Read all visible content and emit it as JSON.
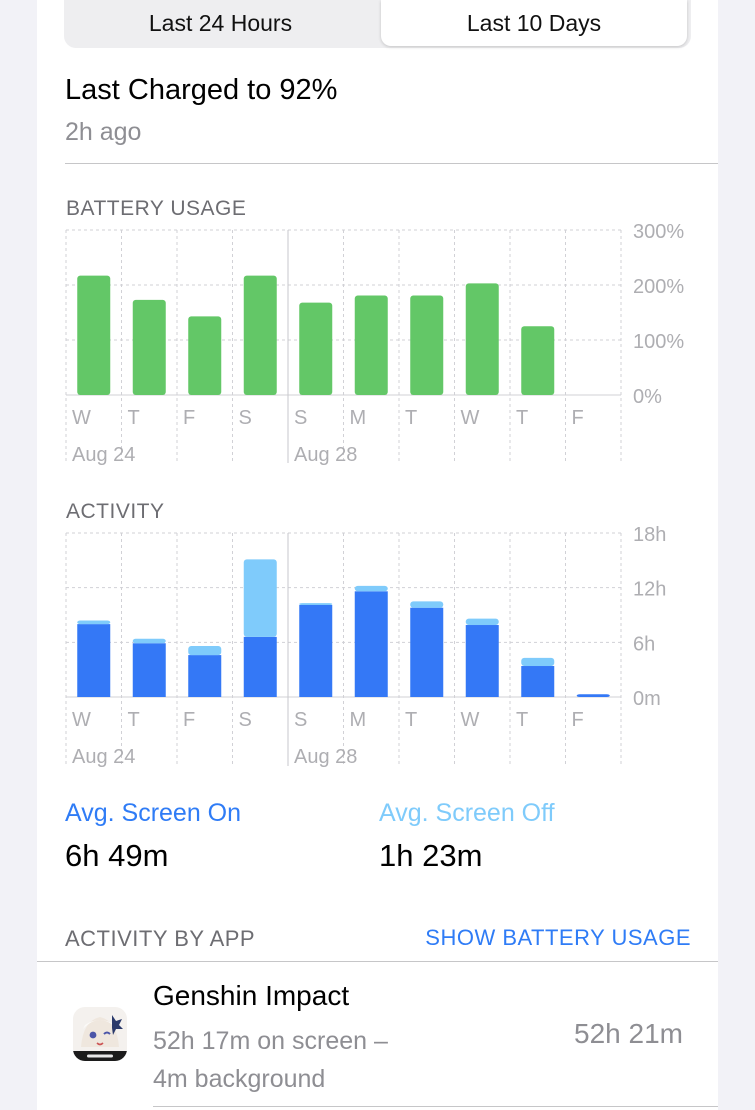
{
  "segmented_control": {
    "options": [
      "Last 24 Hours",
      "Last 10 Days"
    ],
    "selected": "Last 10 Days"
  },
  "last_charged": {
    "title": "Last Charged to 92%",
    "subtitle": "2h ago"
  },
  "battery_section": {
    "label": "BATTERY USAGE"
  },
  "activity_section": {
    "label": "ACTIVITY"
  },
  "chart_data": [
    {
      "type": "bar",
      "title": "BATTERY USAGE",
      "categories": [
        "W",
        "T",
        "F",
        "S",
        "S",
        "M",
        "T",
        "W",
        "T",
        "F"
      ],
      "date_labels": [
        "Aug 24",
        "Aug 28"
      ],
      "y_ticks": [
        "300%",
        "200%",
        "100%",
        "0%"
      ],
      "ylim": [
        0,
        300
      ],
      "color": "#63c767",
      "values": [
        217,
        173,
        143,
        217,
        168,
        181,
        181,
        203,
        125,
        0
      ]
    },
    {
      "type": "bar",
      "title": "ACTIVITY",
      "categories": [
        "W",
        "T",
        "F",
        "S",
        "S",
        "M",
        "T",
        "W",
        "T",
        "F"
      ],
      "date_labels": [
        "Aug 24",
        "Aug 28"
      ],
      "y_ticks": [
        "18h",
        "12h",
        "6h",
        "0m"
      ],
      "ylim": [
        0,
        18
      ],
      "stacked": true,
      "series": [
        {
          "name": "Avg. Screen On",
          "color": "#3478f6",
          "values": [
            8.0,
            5.9,
            4.6,
            6.6,
            10.1,
            11.6,
            9.8,
            7.9,
            3.4,
            0.3
          ]
        },
        {
          "name": "Avg. Screen Off",
          "color": "#7fcbfb",
          "values": [
            0.4,
            0.5,
            1.0,
            8.5,
            0.2,
            0.6,
            0.7,
            0.7,
            0.9,
            0.0
          ]
        }
      ]
    }
  ],
  "summary": {
    "screen_on_label": "Avg. Screen On",
    "screen_on_value": "6h 49m",
    "screen_off_label": "Avg. Screen Off",
    "screen_off_value": "1h 23m",
    "screen_on_color": "#2f7cf6",
    "screen_off_color": "#7fcbfb"
  },
  "activity_by_app": {
    "label": "ACTIVITY BY APP",
    "toggle_label": "SHOW BATTERY USAGE",
    "apps": [
      {
        "name": "Genshin Impact",
        "detail_line1": "52h 17m on screen –",
        "detail_line2": "4m background",
        "total": "52h 21m",
        "icon": "genshin-impact-app-icon"
      }
    ]
  }
}
